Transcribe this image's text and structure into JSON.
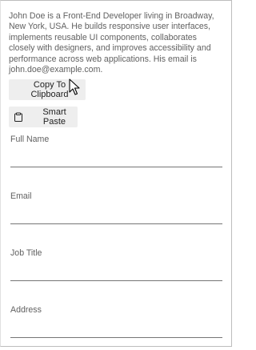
{
  "bio": {
    "text": "John Doe is a Front-End Developer living in Broadway, New York, USA. He builds responsive user interfaces, implements reusable UI components, collaborates closely with designers, and improves accessibility and performance across web applications. His email is john.doe@example.com."
  },
  "actions": {
    "copy_label": "Copy To Clipboard",
    "paste_label": "Smart Paste",
    "paste_icon": "clipboard-icon"
  },
  "form": {
    "fields": [
      {
        "label": "Full Name",
        "value": ""
      },
      {
        "label": "Email",
        "value": ""
      },
      {
        "label": "Job Title",
        "value": ""
      },
      {
        "label": "Address",
        "value": ""
      }
    ]
  }
}
